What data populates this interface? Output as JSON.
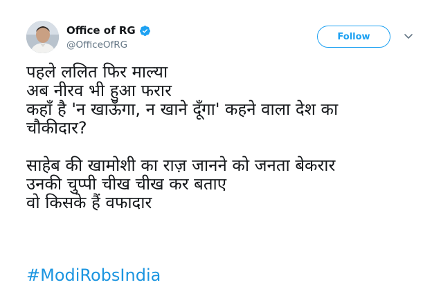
{
  "account": {
    "display_name": "Office of RG",
    "handle": "@OfficeOfRG",
    "verified": true
  },
  "actions": {
    "follow_label": "Follow"
  },
  "tweet": {
    "stanza1": [
      "पहले ललित फिर माल्या",
      "अब नीरव भी हुआ फरार",
      "कहाँ है 'न खाऊँगा, न खाने दूँगा' कहने वाला देश का",
      "चौकीदार?"
    ],
    "stanza2": [
      "साहेब की खामोशी का राज़ जानने को जनता बेकरार",
      "उनकी चुप्पी चीख चीख कर बताए",
      "वो किसके हैं वफादार"
    ],
    "hashtag": "#ModiRobsIndia"
  },
  "colors": {
    "accent": "#1da1f2",
    "hashtag": "#1b95e0",
    "text": "#14171a",
    "muted": "#657786"
  },
  "icons": {
    "verified": "verified-badge-icon",
    "more": "chevron-down-icon"
  }
}
